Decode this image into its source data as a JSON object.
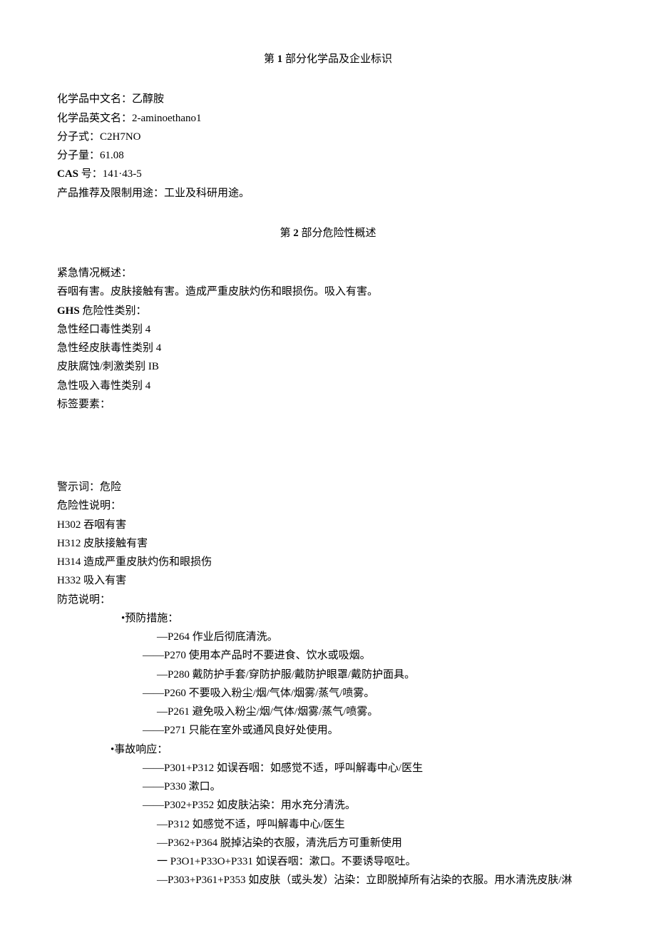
{
  "section1": {
    "title_prefix": "第 ",
    "title_num": "1",
    "title_suffix": " 部分化学品及企业标识",
    "name_cn_label": "化学品中文名：",
    "name_cn": "乙醇胺",
    "name_en_label": "化学品英文名：",
    "name_en": "2-aminoethano1",
    "formula_label": "分子式：",
    "formula": "C2H7NO",
    "mw_label": "分子量：",
    "mw": "61.08",
    "cas_label": "CAS",
    "cas_label2": " 号：",
    "cas": "141·43-5",
    "use_label": "产品推荐及限制用途：",
    "use": "工业及科研用途。"
  },
  "section2": {
    "title_prefix": "第 ",
    "title_num": "2",
    "title_suffix": " 部分危险性概述",
    "emergency_label": "紧急情况概述：",
    "emergency_text": "吞咽有害。皮肤接触有害。造成严重皮肤灼伤和眼损伤。吸入有害。",
    "ghs_label_bold": "GHS",
    "ghs_label_rest": " 危险性类别：",
    "ghs1": "急性经口毒性类别 4",
    "ghs2": "急性经皮肤毒性类别 4",
    "ghs3": "皮肤腐蚀/刺激类别 IB",
    "ghs4": "急性吸入毒性类别 4",
    "label_elements": "标签要素：",
    "signal_label": "警示词：",
    "signal": "危险",
    "hazard_label": "危险性说明：",
    "h302": "H302 吞咽有害",
    "h312": "H312 皮肤接触有害",
    "h314": "H314 造成严重皮肤灼伤和眼损伤",
    "h332": "H332 吸入有害",
    "precaution_label": "防范说明：",
    "prevention_header": "•预防措施：",
    "p264": "—P264 作业后彻底清洗。",
    "p270": "——P270 使用本产品时不要进食、饮水或吸烟。",
    "p280": "—P280 戴防护手套/穿防护服/戴防护眼罩/戴防护面具。",
    "p260": "——P260 不要吸入粉尘/烟/气体/烟雾/蒸气/喷雾。",
    "p261": "—P261 避免吸入粉尘/烟/气体/烟雾/蒸气/喷雾。",
    "p271": "——P271 只能在室外或通风良好处使用。",
    "response_header": "•事故响应：",
    "p301_312": "——P301+P312 如误吞咽：如感觉不适，呼叫解毒中心/医生",
    "p330": "——P330 漱口。",
    "p302_352": "——P302+P352 如皮肤沾染：用水充分清洗。",
    "p312": "—P312 如感觉不适，呼叫解毒中心/医生",
    "p362_364": "—P362+P364 脱掉沾染的衣服，清洗后方可重新使用",
    "p301_330_331": "一 P3O1+P33O+P331 如误吞咽：漱口。不要诱导呕吐。",
    "p303_361_353": "—P303+P361+P353 如皮肤（或头发）沾染：立即脱掉所有沾染的衣服。用水清洗皮肤/淋"
  }
}
